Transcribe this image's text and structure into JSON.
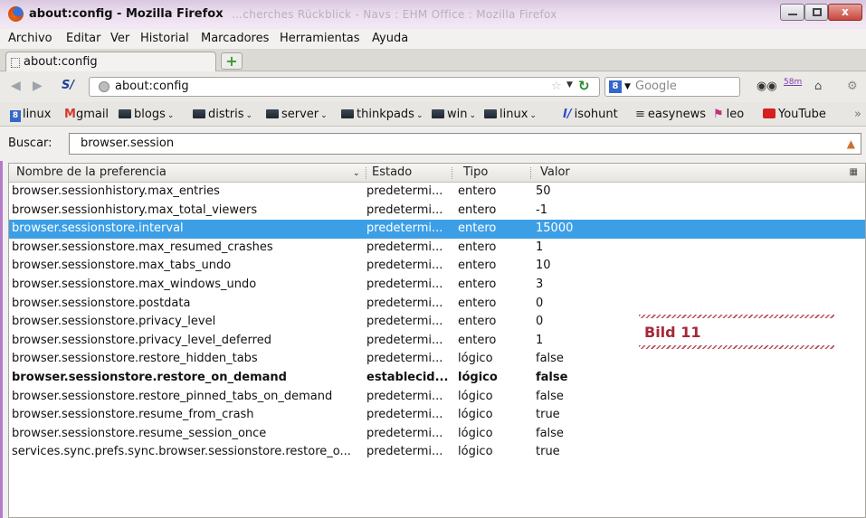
{
  "window": {
    "title": "about:config - Mozilla Firefox",
    "ghost_title": "…cherches Rückblick - Navs : EHM Office : Mozilla Firefox",
    "close_glyph": "x"
  },
  "menu": [
    {
      "label": "Archivo"
    },
    {
      "label": "Editar"
    },
    {
      "label": "Ver"
    },
    {
      "label": "Historial"
    },
    {
      "label": "Marcadores"
    },
    {
      "label": "Herramientas"
    },
    {
      "label": "Ayuda"
    }
  ],
  "tab": {
    "label": "about:config",
    "new_tab_glyph": "+"
  },
  "nav": {
    "url": "about:config",
    "search_placeholder": "Google",
    "search_engine_letter": "8",
    "counter": "58m",
    "s_icon": "S/"
  },
  "bookmarks": [
    {
      "label": "linux",
      "icon": "linux-icon"
    },
    {
      "label": "gmail",
      "icon": "gmail-icon"
    },
    {
      "label": "blogs",
      "icon": "folder-icon",
      "dropdown": true
    },
    {
      "label": "distris",
      "icon": "folder-icon",
      "dropdown": true
    },
    {
      "label": "server",
      "icon": "folder-icon",
      "dropdown": true
    },
    {
      "label": "thinkpads",
      "icon": "folder-icon",
      "dropdown": true
    },
    {
      "label": "win",
      "icon": "folder-icon",
      "dropdown": true
    },
    {
      "label": "linux",
      "icon": "folder-icon",
      "dropdown": true
    },
    {
      "label": "isohunt",
      "icon": "isohunt-icon"
    },
    {
      "label": "easynews",
      "icon": "easynews-icon"
    },
    {
      "label": "leo",
      "icon": "leo-icon"
    },
    {
      "label": "YouTube",
      "icon": "youtube-icon"
    }
  ],
  "filter": {
    "label": "Buscar:",
    "value": "browser.session"
  },
  "table": {
    "headers": {
      "name": "Nombre de la preferencia",
      "state": "Estado",
      "type": "Tipo",
      "value": "Valor"
    },
    "rows": [
      {
        "name": "browser.sessionhistory.max_entries",
        "state": "predetermi...",
        "type": "entero",
        "value": "50"
      },
      {
        "name": "browser.sessionhistory.max_total_viewers",
        "state": "predetermi...",
        "type": "entero",
        "value": "-1"
      },
      {
        "name": "browser.sessionstore.interval",
        "state": "predetermi...",
        "type": "entero",
        "value": "15000",
        "selected": true
      },
      {
        "name": "browser.sessionstore.max_resumed_crashes",
        "state": "predetermi...",
        "type": "entero",
        "value": "1"
      },
      {
        "name": "browser.sessionstore.max_tabs_undo",
        "state": "predetermi...",
        "type": "entero",
        "value": "10"
      },
      {
        "name": "browser.sessionstore.max_windows_undo",
        "state": "predetermi...",
        "type": "entero",
        "value": "3"
      },
      {
        "name": "browser.sessionstore.postdata",
        "state": "predetermi...",
        "type": "entero",
        "value": "0"
      },
      {
        "name": "browser.sessionstore.privacy_level",
        "state": "predetermi...",
        "type": "entero",
        "value": "0"
      },
      {
        "name": "browser.sessionstore.privacy_level_deferred",
        "state": "predetermi...",
        "type": "entero",
        "value": "1"
      },
      {
        "name": "browser.sessionstore.restore_hidden_tabs",
        "state": "predetermi...",
        "type": "lógico",
        "value": "false"
      },
      {
        "name": "browser.sessionstore.restore_on_demand",
        "state": "establecid...",
        "type": "lógico",
        "value": "false",
        "bold": true
      },
      {
        "name": "browser.sessionstore.restore_pinned_tabs_on_demand",
        "state": "predetermi...",
        "type": "lógico",
        "value": "false"
      },
      {
        "name": "browser.sessionstore.resume_from_crash",
        "state": "predetermi...",
        "type": "lógico",
        "value": "true"
      },
      {
        "name": "browser.sessionstore.resume_session_once",
        "state": "predetermi...",
        "type": "lógico",
        "value": "false"
      },
      {
        "name": "services.sync.prefs.sync.browser.sessionstore.restore_o...",
        "state": "predetermi...",
        "type": "lógico",
        "value": "true"
      }
    ]
  },
  "annotation": {
    "text": "Bild 11"
  },
  "colors": {
    "selection": "#3c9fe6",
    "annotation_text": "#a5283a",
    "titlebar": "#eadcee"
  }
}
